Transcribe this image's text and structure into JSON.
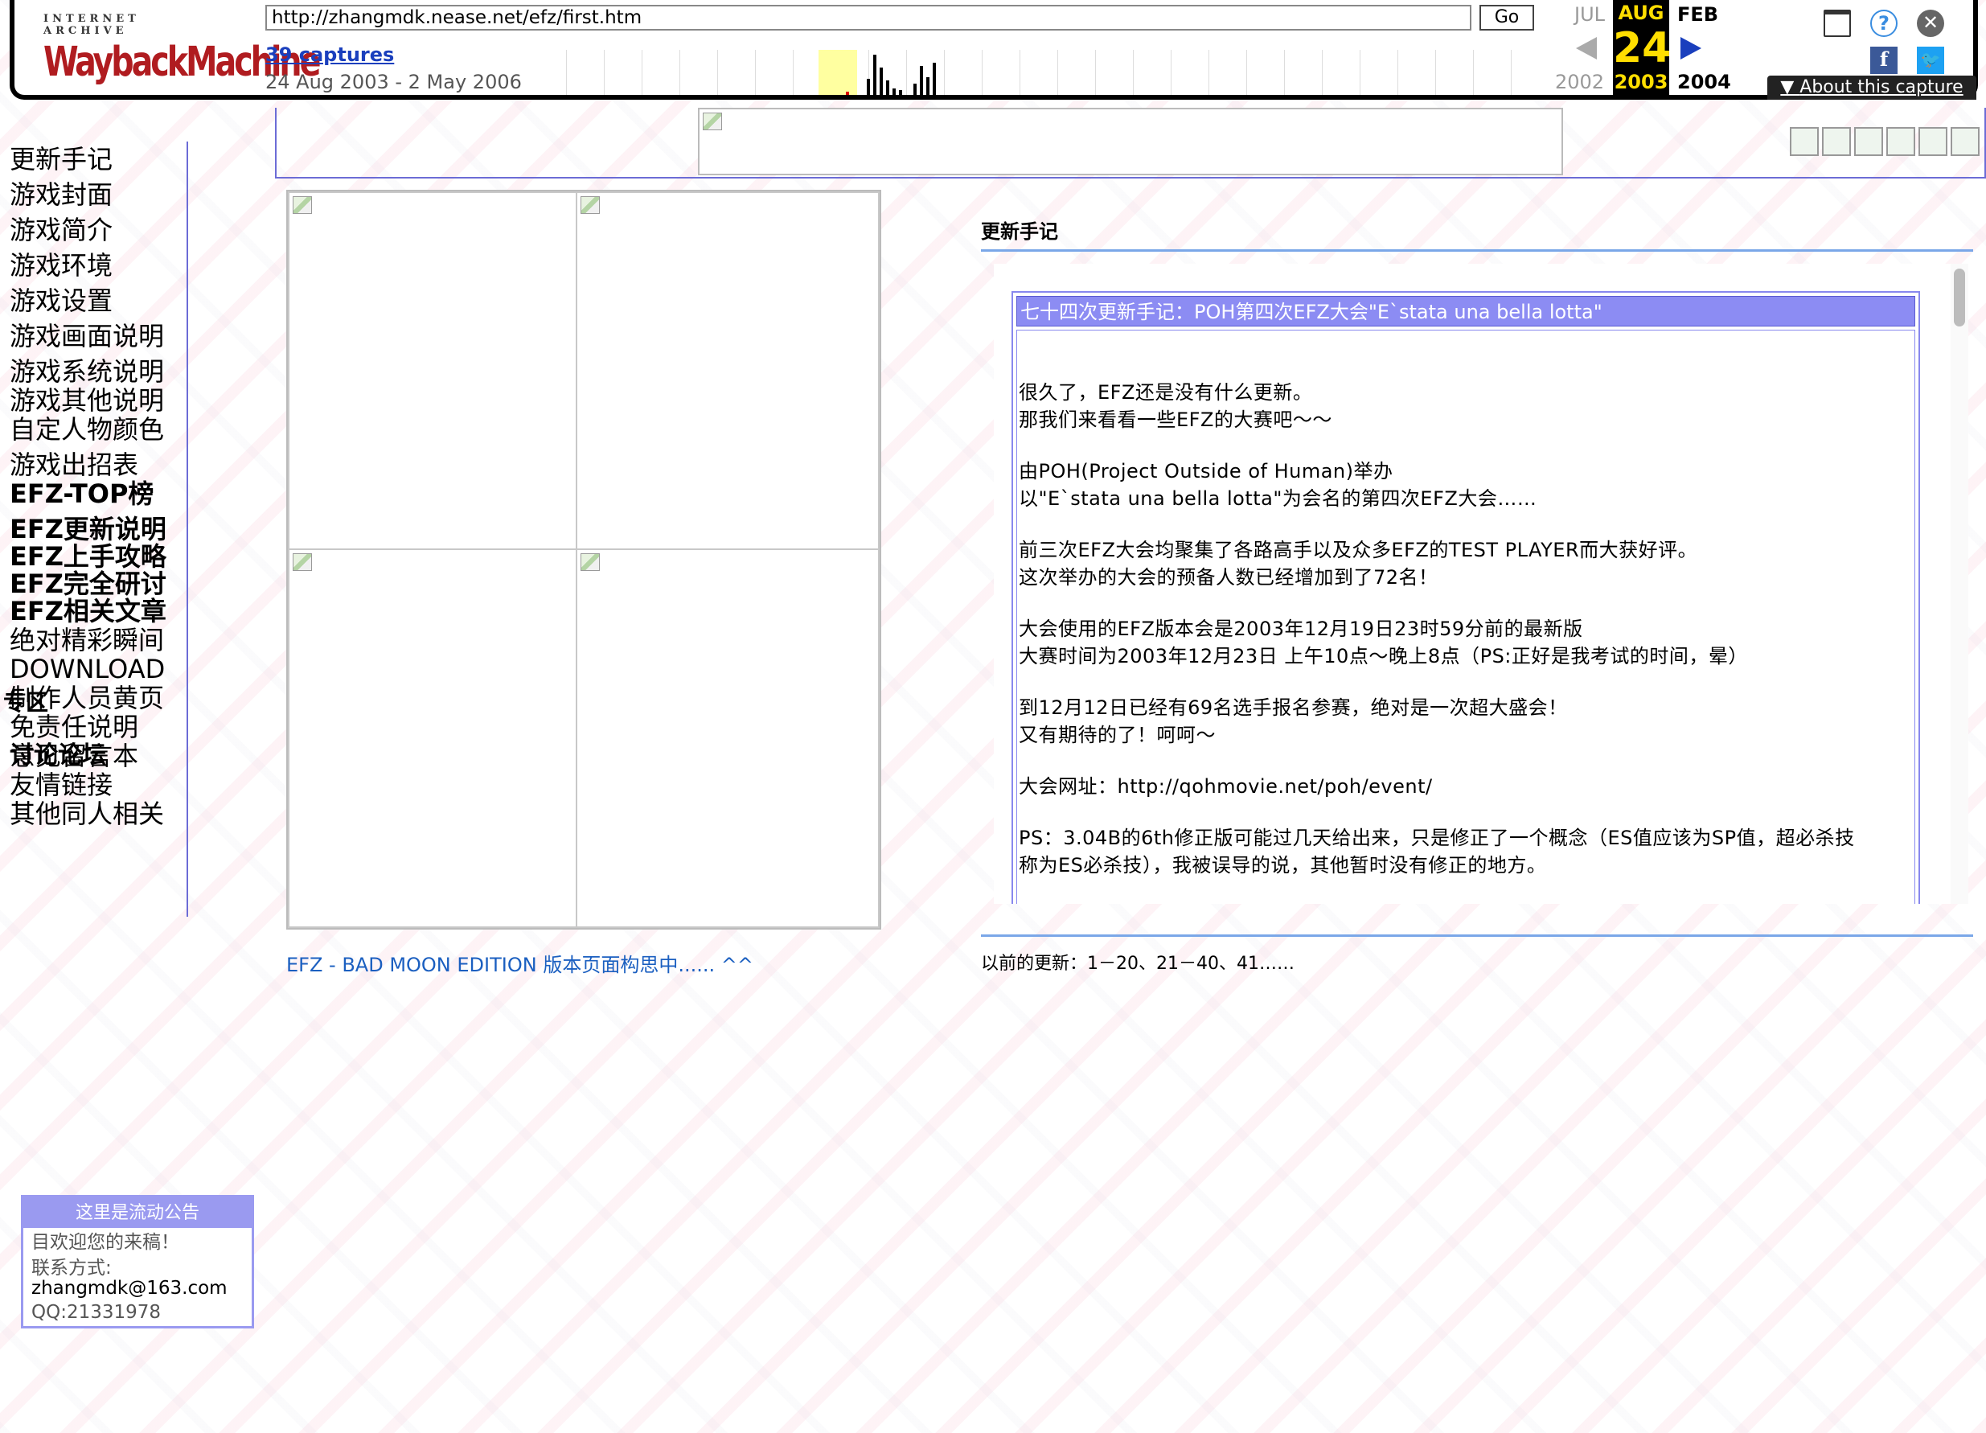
{
  "wayback": {
    "logo_top": "INTERNET ARCHIVE",
    "logo_main": "WaybackMachine",
    "url": "http://zhangmdk.nease.net/efz/first.htm",
    "go_label": "Go",
    "captures_link": "39 captures",
    "date_range": "24 Aug 2003 - 2 May 2006",
    "prev_month": "JUL",
    "current_month": "AUG",
    "next_month": "FEB",
    "current_day": "24",
    "prev_year": "2002",
    "current_year": "2003",
    "next_year": "2004",
    "about_label": "About this capture",
    "colors": {
      "year_highlight": "#ffde00",
      "link": "#1a3fbd",
      "logo": "#b01c20"
    }
  },
  "nav": {
    "items": [
      {
        "label": "更新手记"
      },
      {
        "label": "游戏封面"
      },
      {
        "label": "游戏简介"
      },
      {
        "label": "游戏环境"
      },
      {
        "label": "游戏设置"
      },
      {
        "label": "游戏画面说明"
      },
      {
        "label": "游戏系统说明"
      },
      {
        "label": "游戏其他说明"
      },
      {
        "label": "自定人物颜色"
      },
      {
        "label": "游戏出招表"
      },
      {
        "label": "EFZ-TOP榜"
      },
      {
        "label": "EFZ更新说明"
      },
      {
        "label": "EFZ上手攻略"
      },
      {
        "label": "EFZ完全研讨"
      },
      {
        "label": "EFZ相关文章"
      },
      {
        "label": "绝对精彩瞬间"
      },
      {
        "label": "DOWNLOAD"
      },
      {
        "label": "制作人员黄页"
      },
      {
        "label": "专区"
      },
      {
        "label": "免责任说明"
      },
      {
        "label": "意见留言本"
      },
      {
        "label": "讨论论坛"
      },
      {
        "label": "友情链接"
      },
      {
        "label": "其他同人相关"
      }
    ]
  },
  "main": {
    "caption": "EFZ - BAD MOON EDITION 版本页面构思中...... ^^"
  },
  "updates": {
    "title": "更新手记",
    "entry_title": "七十四次更新手记：POH第四次EFZ大会\"E`stata una bella lotta\"",
    "lines": [
      "很久了，EFZ还是没有什么更新。",
      "那我们来看看一些EFZ的大赛吧～～",
      "由POH(Project Outside of Human)举办",
      "以\"E`stata una bella lotta\"为会名的第四次EFZ大会……",
      "前三次EFZ大会均聚集了各路高手以及众多EFZ的TEST PLAYER而大获好评。",
      "这次举办的大会的预备人数已经增加到了72名！",
      "大会使用的EFZ版本会是2003年12月19日23时59分前的最新版",
      "大赛时间为2003年12月23日 上午10点～晚上8点（PS:正好是我考试的时间，晕）",
      "到12月12日已经有69名选手报名参赛，绝对是一次超大盛会！",
      "又有期待的了！呵呵～",
      "大会网址：http://qohmovie.net/poh/event/",
      "PS：3.04B的6th修正版可能过几天给出来，只是修正了一个概念（ES值应该为SP值，超必杀技",
      "称为ES必杀技），我被误导的说，其他暂时没有修正的地方。"
    ],
    "previous": "以前的更新：1－20、21－40、41……"
  },
  "notice": {
    "title": "这里是流动公告",
    "lines": [
      "目欢迎您的来稿！",
      "联系方式:",
      "zhangmdk@163.com",
      "QQ:21331978"
    ]
  }
}
